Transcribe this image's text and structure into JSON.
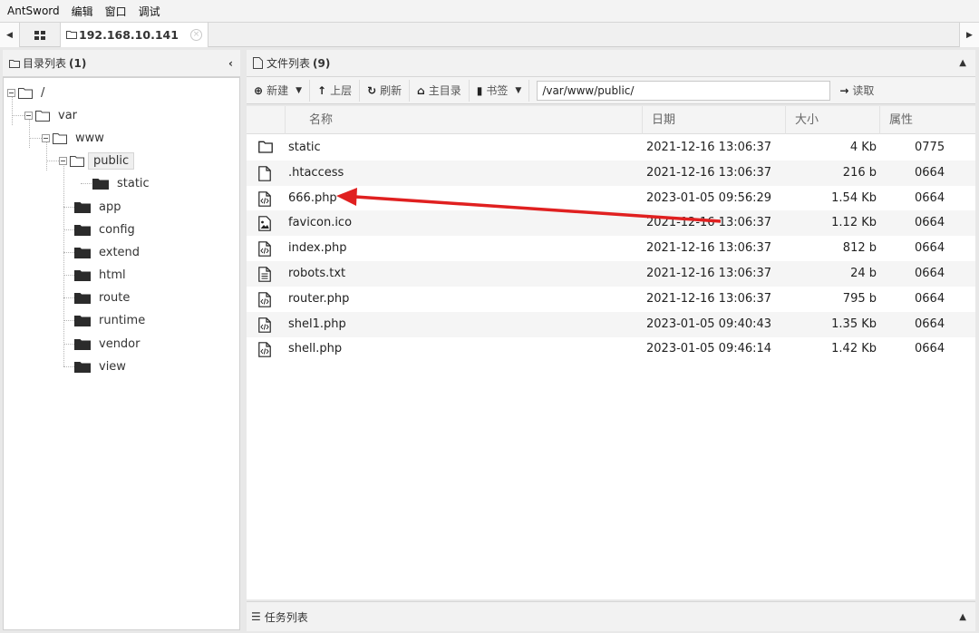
{
  "menubar": [
    "AntSword",
    "编辑",
    "窗口",
    "调试"
  ],
  "tab": {
    "host": "192.168.10.141",
    "close": "×"
  },
  "dir_panel": {
    "title": "目录列表",
    "count": "(1)"
  },
  "file_panel": {
    "title": "文件列表",
    "count": "(9)"
  },
  "tree": [
    {
      "label": "/",
      "icon": "folder-outline-icon"
    },
    {
      "label": "var",
      "icon": "folder-outline-icon"
    },
    {
      "label": "www",
      "icon": "folder-outline-icon"
    },
    {
      "label": "public",
      "icon": "folder-outline-icon",
      "selected": true
    },
    {
      "label": "static",
      "icon": "folder-filled-icon"
    },
    {
      "label": "app",
      "icon": "folder-filled-icon"
    },
    {
      "label": "config",
      "icon": "folder-filled-icon"
    },
    {
      "label": "extend",
      "icon": "folder-filled-icon"
    },
    {
      "label": "html",
      "icon": "folder-filled-icon"
    },
    {
      "label": "route",
      "icon": "folder-filled-icon"
    },
    {
      "label": "runtime",
      "icon": "folder-filled-icon"
    },
    {
      "label": "vendor",
      "icon": "folder-filled-icon"
    },
    {
      "label": "view",
      "icon": "folder-filled-icon"
    }
  ],
  "toolbar": {
    "new": "新建",
    "up": "上层",
    "refresh": "刷新",
    "home": "主目录",
    "bookmark": "书签",
    "path": "/var/www/public/",
    "read": "读取"
  },
  "columns": {
    "name": "名称",
    "date": "日期",
    "size": "大小",
    "attr": "属性"
  },
  "files": [
    {
      "name": "static",
      "date": "2021-12-16 13:06:37",
      "size": "4 Kb",
      "attr": "0775",
      "icon": "folder-icon"
    },
    {
      "name": ".htaccess",
      "date": "2021-12-16 13:06:37",
      "size": "216 b",
      "attr": "0664",
      "icon": "file-icon"
    },
    {
      "name": "666.php",
      "date": "2023-01-05 09:56:29",
      "size": "1.54 Kb",
      "attr": "0664",
      "icon": "code-file-icon"
    },
    {
      "name": "favicon.ico",
      "date": "2021-12-16 13:06:37",
      "size": "1.12 Kb",
      "attr": "0664",
      "icon": "image-file-icon"
    },
    {
      "name": "index.php",
      "date": "2021-12-16 13:06:37",
      "size": "812 b",
      "attr": "0664",
      "icon": "code-file-icon"
    },
    {
      "name": "robots.txt",
      "date": "2021-12-16 13:06:37",
      "size": "24 b",
      "attr": "0664",
      "icon": "text-file-icon"
    },
    {
      "name": "router.php",
      "date": "2021-12-16 13:06:37",
      "size": "795 b",
      "attr": "0664",
      "icon": "code-file-icon"
    },
    {
      "name": "shel1.php",
      "date": "2023-01-05 09:40:43",
      "size": "1.35 Kb",
      "attr": "0664",
      "icon": "code-file-icon"
    },
    {
      "name": "shell.php",
      "date": "2023-01-05 09:46:14",
      "size": "1.42 Kb",
      "attr": "0664",
      "icon": "code-file-icon"
    }
  ],
  "tasks_panel": {
    "title": "任务列表"
  },
  "colors": {
    "annotation_arrow": "#e02020"
  }
}
